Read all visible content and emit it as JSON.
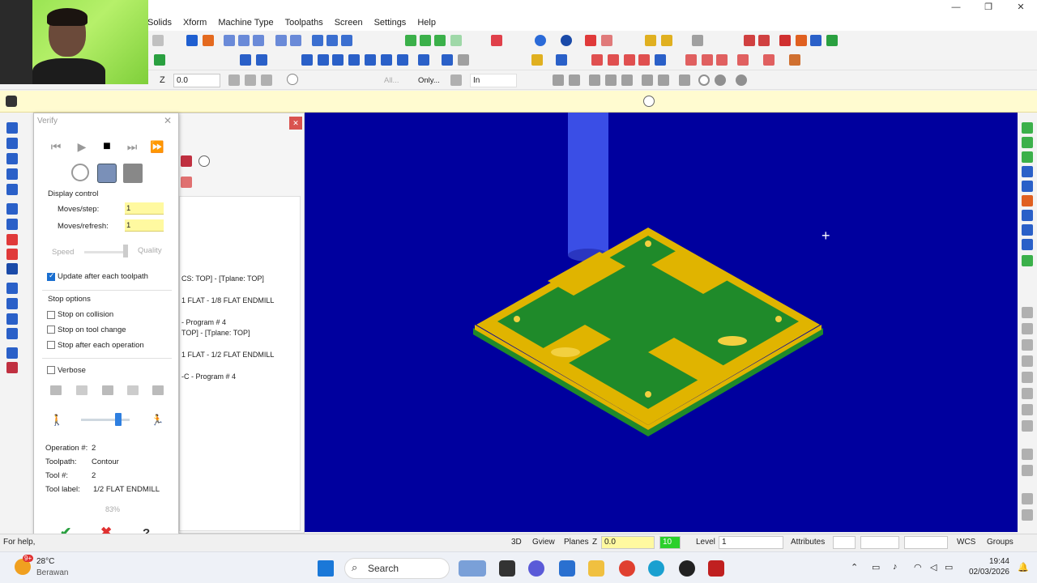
{
  "menu": [
    "Solids",
    "Xform",
    "Machine Type",
    "Toolpaths",
    "Screen",
    "Settings",
    "Help"
  ],
  "window_controls": [
    "—",
    "❐",
    "✕"
  ],
  "toolbar3": {
    "z_label": "Z",
    "z_value": "0.0",
    "all_button": "All...",
    "only_button": "Only...",
    "in_select": "In"
  },
  "verify": {
    "title": "Verify",
    "display_control": "Display control",
    "moves_step_label": "Moves/step:",
    "moves_step_value": "1",
    "moves_refresh_label": "Moves/refresh:",
    "moves_refresh_value": "1",
    "speed_label": "Speed",
    "quality_label": "Quality",
    "update_after_toolpath": "Update after each toolpath",
    "stop_options": "Stop options",
    "stop_on_collision": "Stop on collision",
    "stop_on_tool_change": "Stop on tool change",
    "stop_after_operation": "Stop after each operation",
    "verbose": "Verbose",
    "speed_level": 0.8,
    "info": {
      "operation_label": "Operation #:",
      "operation_value": "2",
      "toolpath_label": "Toolpath:",
      "toolpath_value": "Contour",
      "tool_label": "Tool #:",
      "tool_value": "2",
      "toollabel_label": "Tool label:",
      "toollabel_value": "1/2 FLAT ENDMILL"
    },
    "progress": "83%"
  },
  "toolpaths_panel": {
    "lines": [
      "CS: TOP] - [Tplane: TOP]",
      "1 FLAT - 1/8 FLAT ENDMILL",
      "- Program # 4",
      "TOP] - [Tplane: TOP]",
      "1 FLAT - 1/2 FLAT ENDMILL",
      "-C - Program # 4"
    ]
  },
  "status_bar": {
    "for_help": "For help,",
    "mode_3d": "3D",
    "gview": "Gview",
    "planes": "Planes",
    "z_label": "Z",
    "z_value": "0.0",
    "color_value": "10",
    "level_label": "Level",
    "level_value": "1",
    "attributes": "Attributes",
    "wcs": "WCS",
    "groups": "Groups"
  },
  "taskbar": {
    "weather_temp": "28°C",
    "weather_desc": "Berawan",
    "weather_badge": "9+",
    "search_placeholder": "Search",
    "time": "19:44",
    "date": "02/03/2026"
  },
  "colors": {
    "viewport_bg": "#00009e",
    "part_top": "#1f8a2a",
    "part_side": "#e0b400",
    "tool": "#3a4ee6",
    "prompt_bg": "#fffbd0"
  }
}
